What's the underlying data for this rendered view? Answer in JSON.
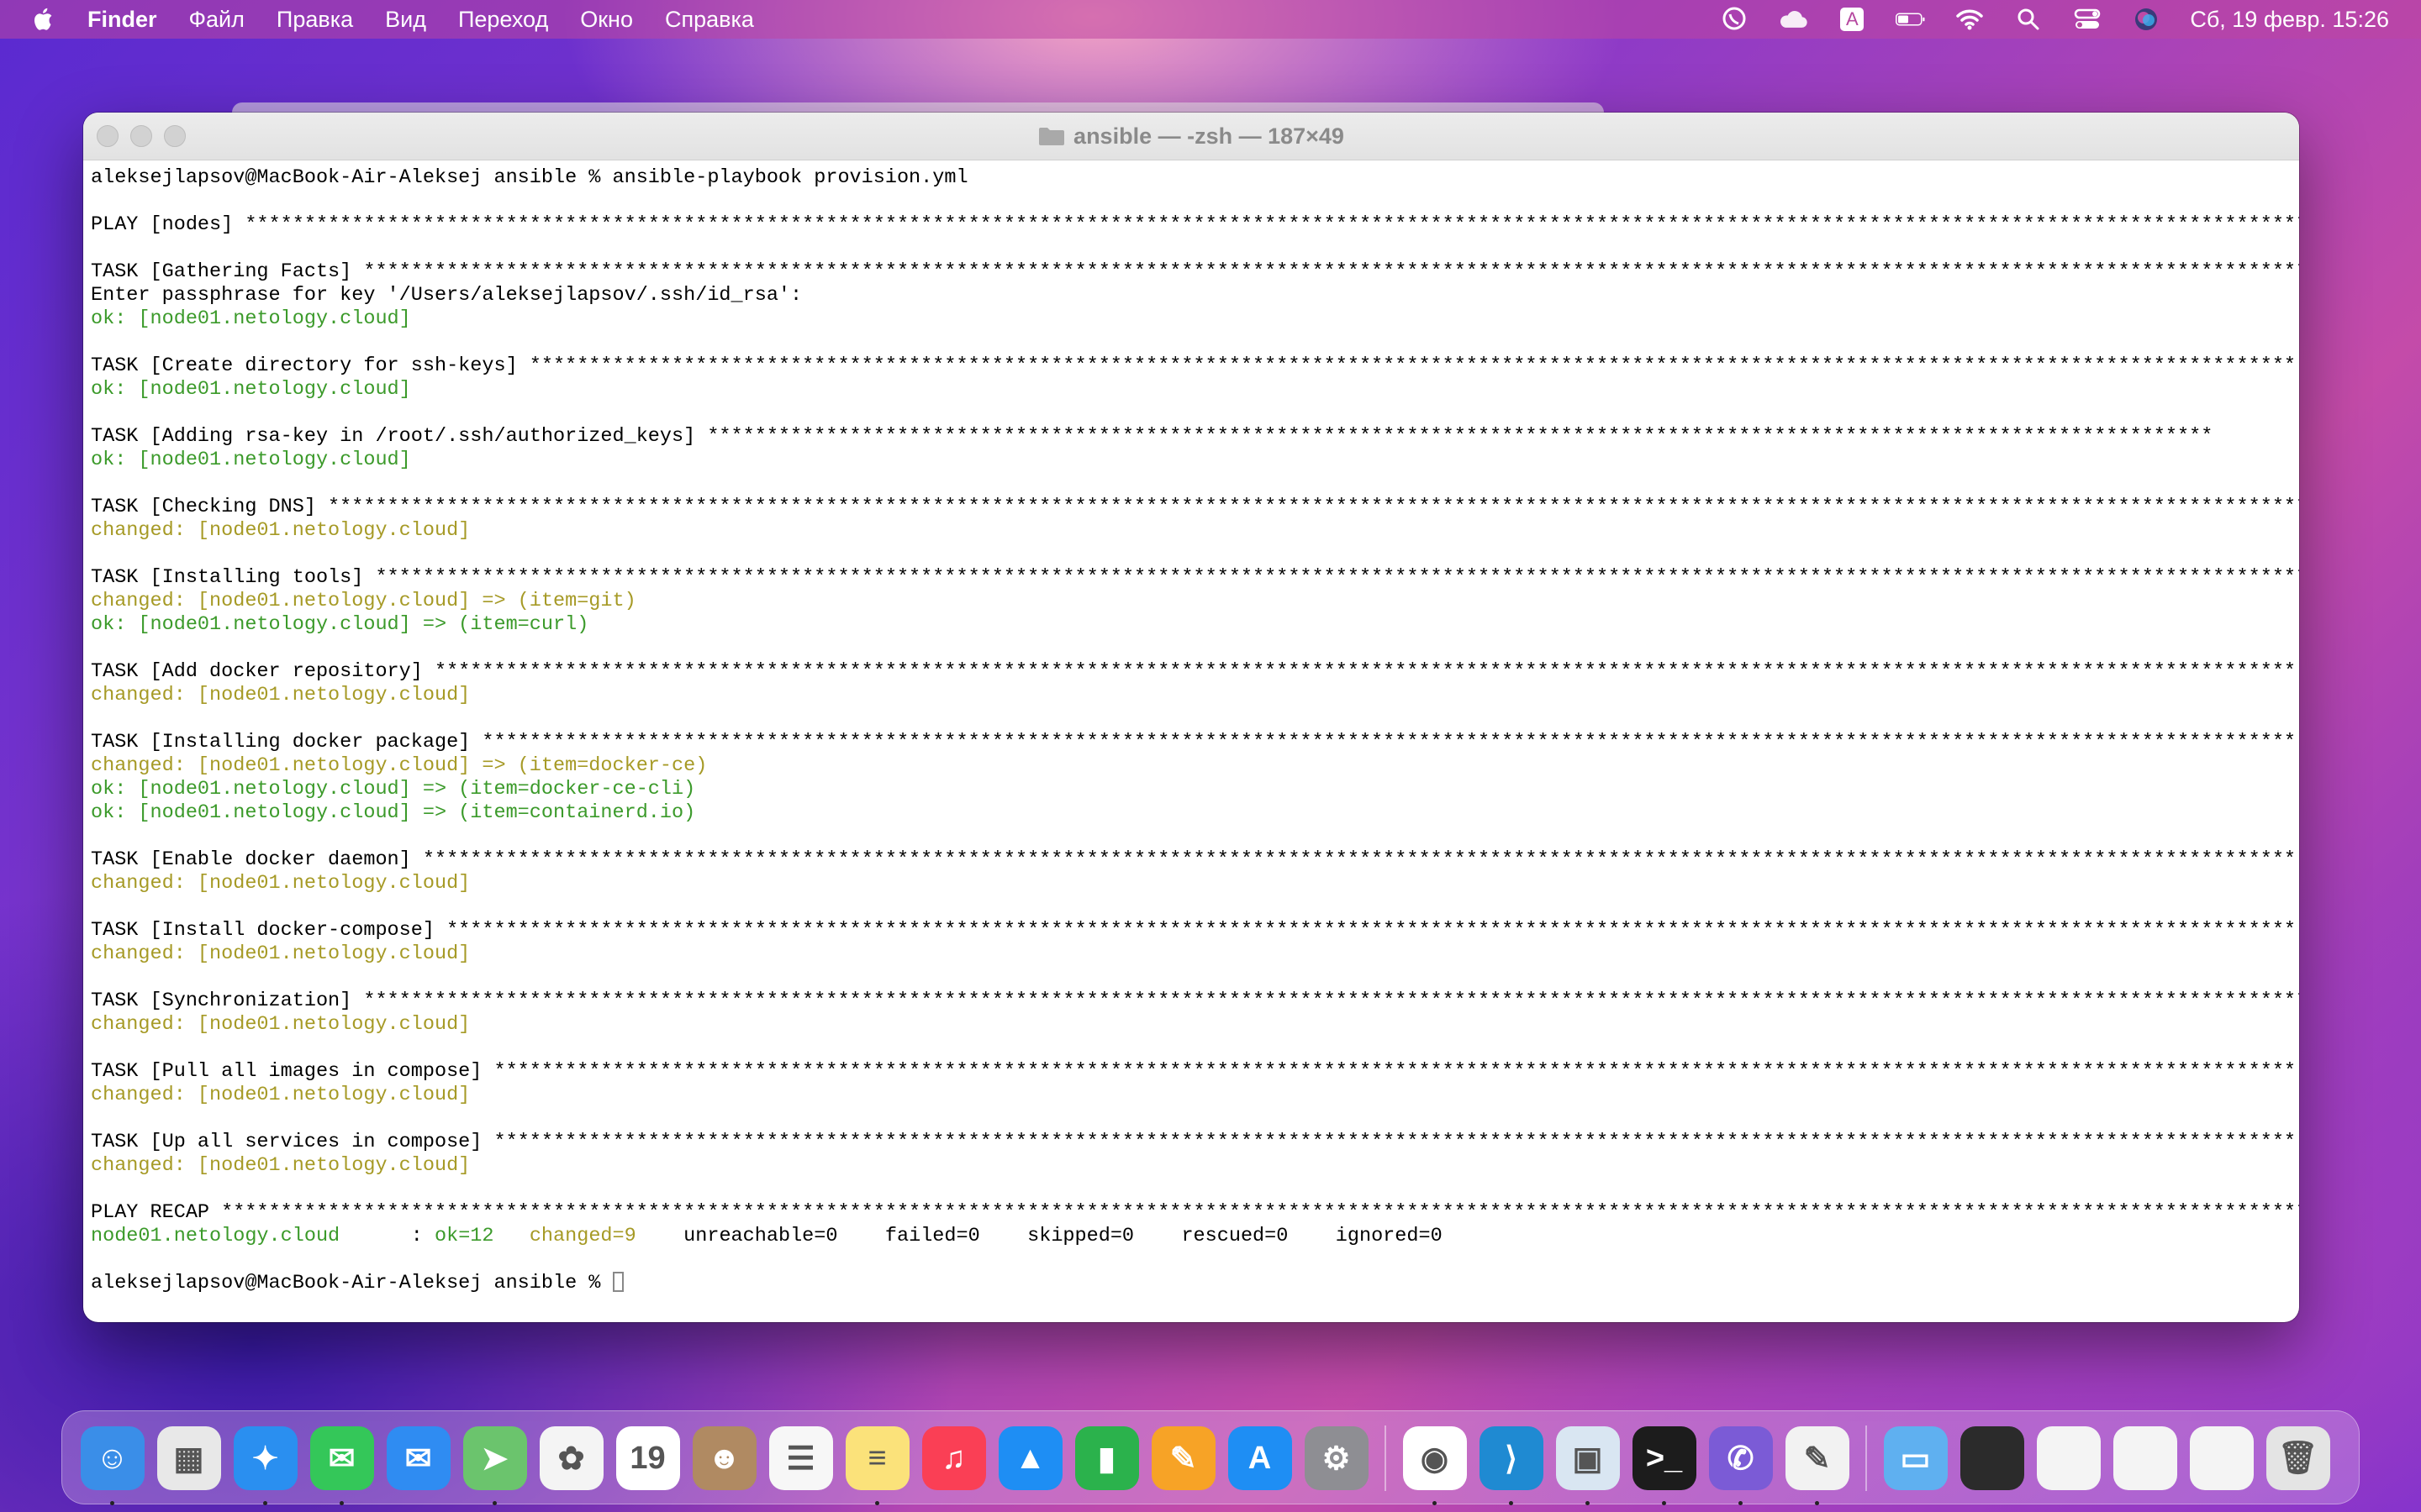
{
  "menubar": {
    "apple_icon": "apple-icon",
    "app_name": "Finder",
    "items": [
      "Файл",
      "Правка",
      "Вид",
      "Переход",
      "Окно",
      "Справка"
    ],
    "status_icons": [
      "viber-icon",
      "icloud-icon",
      "keyboard-layout-icon",
      "battery-icon",
      "wifi-icon",
      "search-icon",
      "control-center-icon",
      "siri-icon"
    ],
    "keyboard_layout": "A",
    "clock": "Сб, 19 февр.  15:26"
  },
  "terminal": {
    "title": "ansible — -zsh — 187×49",
    "lines": [
      {
        "t": "aleksejlapsov@MacBook-Air-Aleksej ansible % ansible-playbook provision.yml",
        "c": ""
      },
      {
        "t": "",
        "c": ""
      },
      {
        "t": "PLAY [nodes] *********************************************************************************************************************************************************************************************",
        "c": ""
      },
      {
        "t": "",
        "c": ""
      },
      {
        "t": "TASK [Gathering Facts] ***************************************************************************************************************************************************************************",
        "c": ""
      },
      {
        "t": "Enter passphrase for key '/Users/aleksejlapsov/.ssh/id_rsa':",
        "c": ""
      },
      {
        "t": "ok: [node01.netology.cloud]",
        "c": "ok"
      },
      {
        "t": "",
        "c": ""
      },
      {
        "t": "TASK [Create directory for ssh-keys] *****************************************************************************************************************************************************",
        "c": ""
      },
      {
        "t": "ok: [node01.netology.cloud]",
        "c": "ok"
      },
      {
        "t": "",
        "c": ""
      },
      {
        "t": "TASK [Adding rsa-key in /root/.ssh/authorized_keys] *******************************************************************************************************************************",
        "c": ""
      },
      {
        "t": "ok: [node01.netology.cloud]",
        "c": "ok"
      },
      {
        "t": "",
        "c": ""
      },
      {
        "t": "TASK [Checking DNS] *******************************************************************************************************************************************************************************",
        "c": ""
      },
      {
        "t": "changed: [node01.netology.cloud]",
        "c": "changed"
      },
      {
        "t": "",
        "c": ""
      },
      {
        "t": "TASK [Installing tools] **************************************************************************************************************************************************************************",
        "c": ""
      },
      {
        "t": "changed: [node01.netology.cloud] => (item=git)",
        "c": "changed"
      },
      {
        "t": "ok: [node01.netology.cloud] => (item=curl)",
        "c": "ok"
      },
      {
        "t": "",
        "c": ""
      },
      {
        "t": "TASK [Add docker repository] *************************************************************************************************************************************************************",
        "c": ""
      },
      {
        "t": "changed: [node01.netology.cloud]",
        "c": "changed"
      },
      {
        "t": "",
        "c": ""
      },
      {
        "t": "TASK [Installing docker package] *********************************************************************************************************************************************************",
        "c": ""
      },
      {
        "t": "changed: [node01.netology.cloud] => (item=docker-ce)",
        "c": "changed"
      },
      {
        "t": "ok: [node01.netology.cloud] => (item=docker-ce-cli)",
        "c": "ok"
      },
      {
        "t": "ok: [node01.netology.cloud] => (item=containerd.io)",
        "c": "ok"
      },
      {
        "t": "",
        "c": ""
      },
      {
        "t": "TASK [Enable docker daemon] **************************************************************************************************************************************************************",
        "c": ""
      },
      {
        "t": "changed: [node01.netology.cloud]",
        "c": "changed"
      },
      {
        "t": "",
        "c": ""
      },
      {
        "t": "TASK [Install docker-compose] ************************************************************************************************************************************************************",
        "c": ""
      },
      {
        "t": "changed: [node01.netology.cloud]",
        "c": "changed"
      },
      {
        "t": "",
        "c": ""
      },
      {
        "t": "TASK [Synchronization] ***************************************************************************************************************************************************************************",
        "c": ""
      },
      {
        "t": "changed: [node01.netology.cloud]",
        "c": "changed"
      },
      {
        "t": "",
        "c": ""
      },
      {
        "t": "TASK [Pull all images in compose] ********************************************************************************************************************************************************",
        "c": ""
      },
      {
        "t": "changed: [node01.netology.cloud]",
        "c": "changed"
      },
      {
        "t": "",
        "c": ""
      },
      {
        "t": "TASK [Up all services in compose] ********************************************************************************************************************************************************",
        "c": ""
      },
      {
        "t": "changed: [node01.netology.cloud]",
        "c": "changed"
      },
      {
        "t": "",
        "c": ""
      },
      {
        "t": "PLAY RECAP ***********************************************************************************************************************************************************************************************",
        "c": ""
      }
    ],
    "recap": {
      "host": "node01.netology.cloud",
      "sep": "      : ",
      "ok": "ok=12",
      "changed": "changed=9",
      "rest": "    unreachable=0    failed=0    skipped=0    rescued=0    ignored=0"
    },
    "prompt": "aleksejlapsov@MacBook-Air-Aleksej ansible % "
  },
  "dock": {
    "items": [
      {
        "name": "finder",
        "icon": "finder-icon",
        "color": "#3a8ee8",
        "glyph": "☺",
        "running": true
      },
      {
        "name": "launchpad",
        "icon": "launchpad-icon",
        "color": "#e8e8e8",
        "glyph": "▦",
        "running": false
      },
      {
        "name": "safari",
        "icon": "safari-icon",
        "color": "#2a8ff0",
        "glyph": "✦",
        "running": true
      },
      {
        "name": "messages",
        "icon": "messages-icon",
        "color": "#34c759",
        "glyph": "✉",
        "running": true
      },
      {
        "name": "mail",
        "icon": "mail-icon",
        "color": "#2f8cf2",
        "glyph": "✉",
        "running": false
      },
      {
        "name": "maps",
        "icon": "maps-icon",
        "color": "#6bc46d",
        "glyph": "➤",
        "running": true
      },
      {
        "name": "photos",
        "icon": "photos-icon",
        "color": "#f4f4f4",
        "glyph": "✿",
        "running": false
      },
      {
        "name": "calendar",
        "icon": "calendar-icon",
        "color": "#ffffff",
        "glyph": "19",
        "running": false
      },
      {
        "name": "contacts",
        "icon": "contacts-icon",
        "color": "#b08a62",
        "glyph": "☻",
        "running": false
      },
      {
        "name": "reminders",
        "icon": "reminders-icon",
        "color": "#f7f7f7",
        "glyph": "☰",
        "running": false
      },
      {
        "name": "notes",
        "icon": "notes-icon",
        "color": "#fbe27a",
        "glyph": "≡",
        "running": true
      },
      {
        "name": "music",
        "icon": "music-icon",
        "color": "#fa3f55",
        "glyph": "♫",
        "running": false
      },
      {
        "name": "keynote",
        "icon": "keynote-icon",
        "color": "#1e8ef4",
        "glyph": "▲",
        "running": false
      },
      {
        "name": "numbers",
        "icon": "numbers-icon",
        "color": "#2bb24c",
        "glyph": "▮",
        "running": false
      },
      {
        "name": "pages",
        "icon": "pages-icon",
        "color": "#f7a326",
        "glyph": "✎",
        "running": false
      },
      {
        "name": "app-store",
        "icon": "app-store-icon",
        "color": "#1e8ef4",
        "glyph": "A",
        "running": false
      },
      {
        "name": "system-preferences",
        "icon": "gear-icon",
        "color": "#8e8e93",
        "glyph": "⚙",
        "running": false
      },
      {
        "sep": true
      },
      {
        "name": "chrome",
        "icon": "chrome-icon",
        "color": "#ffffff",
        "glyph": "◉",
        "running": true
      },
      {
        "name": "vscode",
        "icon": "vscode-icon",
        "color": "#1f8ad2",
        "glyph": "⟩",
        "running": true
      },
      {
        "name": "preview",
        "icon": "preview-icon",
        "color": "#d9e6f2",
        "glyph": "▣",
        "running": true
      },
      {
        "name": "terminal",
        "icon": "terminal-icon",
        "color": "#1c1c1c",
        "glyph": ">_",
        "running": true
      },
      {
        "name": "viber",
        "icon": "viber-icon",
        "color": "#7b5bd6",
        "glyph": "✆",
        "running": true
      },
      {
        "name": "textedit",
        "icon": "textedit-icon",
        "color": "#f2f2f2",
        "glyph": "✎",
        "running": true
      },
      {
        "sep": true
      },
      {
        "name": "downloads",
        "icon": "folder-icon",
        "color": "#5fb0f0",
        "glyph": "▭",
        "running": false
      },
      {
        "name": "window-thumb-1",
        "icon": "window-thumbnail-icon",
        "color": "#2b2b2b",
        "glyph": "",
        "running": false
      },
      {
        "name": "window-thumb-2",
        "icon": "window-thumbnail-icon",
        "color": "#f4f4f4",
        "glyph": "",
        "running": false
      },
      {
        "name": "window-thumb-3",
        "icon": "window-thumbnail-icon",
        "color": "#f4f4f4",
        "glyph": "",
        "running": false
      },
      {
        "name": "window-thumb-4",
        "icon": "window-thumbnail-icon",
        "color": "#f4f4f4",
        "glyph": "",
        "running": false
      },
      {
        "name": "trash",
        "icon": "trash-icon",
        "color": "#e4e4e4",
        "glyph": "🗑",
        "running": false
      }
    ]
  }
}
